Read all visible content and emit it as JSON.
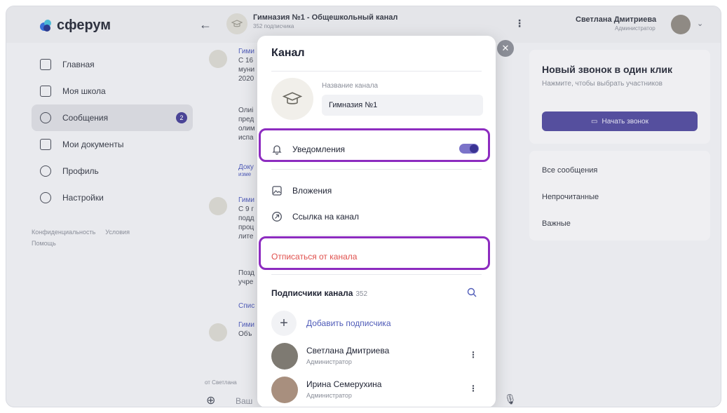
{
  "app": {
    "logo_text": "сферум"
  },
  "topbar": {
    "channel_title": "Гимназия №1 - Общешкольный канал",
    "channel_subtitle": "352 подписчика",
    "user_name": "Светлана Дмитриева",
    "user_role": "Администратор"
  },
  "sidebar": {
    "items": [
      {
        "label": "Главная",
        "icon": "grid-icon"
      },
      {
        "label": "Моя школа",
        "icon": "school-icon"
      },
      {
        "label": "Сообщения",
        "icon": "chat-icon",
        "badge": "2"
      },
      {
        "label": "Мои документы",
        "icon": "document-icon"
      },
      {
        "label": "Профиль",
        "icon": "profile-icon"
      },
      {
        "label": "Настройки",
        "icon": "gear-icon"
      }
    ],
    "links": [
      "Конфиденциальность",
      "Условия",
      "Помощь"
    ]
  },
  "chat": {
    "messages": [
      {
        "sender": "Гими",
        "lines": [
          "С 16",
          "муни",
          "2020"
        ]
      },
      {
        "sender": "",
        "lines": [
          "Олиі",
          "пред",
          "олим",
          "испа"
        ]
      },
      {
        "link": "Доку",
        "link2": "изме"
      },
      {
        "sender": "Гими",
        "lines": [
          "С 9 г",
          "подд",
          "проц",
          "лите"
        ]
      },
      {
        "sender": "",
        "lines": [
          "Позд",
          "учре"
        ]
      },
      {
        "link": "Спис"
      },
      {
        "sender": "Гими",
        "lines": [
          "Объ"
        ]
      }
    ],
    "footer_note": "от Светлана",
    "input_placeholder": "Ваш"
  },
  "right_panel": {
    "call_title": "Новый звонок в один клик",
    "call_subtitle": "Нажмите, чтобы выбрать участников",
    "call_button": "Начать звонок",
    "filters": [
      "Все сообщения",
      "Непрочитанные",
      "Важные"
    ]
  },
  "modal": {
    "title": "Канал",
    "field_label": "Название канала",
    "field_value": "Гимназия №1",
    "notifications_label": "Уведомления",
    "notifications_on": true,
    "attachments_label": "Вложения",
    "channel_link_label": "Ссылка на канал",
    "unsubscribe_label": "Отписаться от канала",
    "subscribers_title": "Подписчики канала",
    "subscribers_count": "352",
    "add_subscriber_label": "Добавить подписчика",
    "members": [
      {
        "name": "Светлана Дмитриева",
        "role": "Администратор"
      },
      {
        "name": "Ирина Семерухина",
        "role": "Администратор"
      }
    ]
  },
  "colors": {
    "accent": "#554f9e",
    "danger": "#e0504d",
    "highlight": "#8d2cc0",
    "link": "#4f5bb8"
  }
}
